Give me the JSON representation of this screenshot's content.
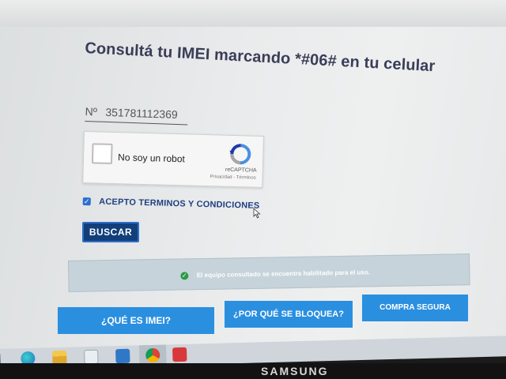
{
  "page": {
    "title": "Consultá tu IMEI marcando *#06# en tu celular"
  },
  "imei": {
    "prefix": "Nº",
    "value": "351781112369"
  },
  "captcha": {
    "label": "No soy un robot",
    "brand": "reCAPTCHA",
    "links": "Privacidad - Términos"
  },
  "terms": {
    "checked": true,
    "label": "ACEPTO TERMINOS Y CONDICIONES"
  },
  "search_button": "BUSCAR",
  "status": {
    "message": "El equipo consultado se encuentra habilitado para el uso.",
    "color": "#2e9a43"
  },
  "nav_buttons": {
    "what_is_imei": "¿QUÉ ES IMEI?",
    "why_blocked": "¿POR QUÉ SE BLOQUEA?",
    "safe_purchase": "COMPRA SEGURA"
  },
  "taskbar": {
    "icons": [
      "edge-icon",
      "file-explorer-icon",
      "store-icon",
      "mail-icon",
      "chrome-icon",
      "anydesk-icon"
    ]
  },
  "monitor": {
    "brand": "SAMSUNG"
  },
  "colors": {
    "accent": "#2b8fe0",
    "title": "#3a3d57",
    "button_dark": "#123f7a"
  }
}
